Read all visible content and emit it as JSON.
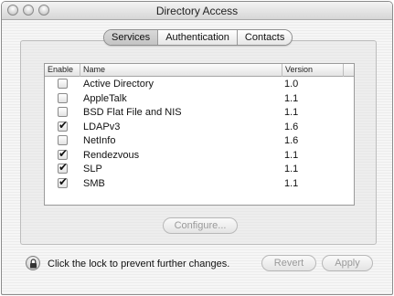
{
  "window": {
    "title": "Directory Access"
  },
  "tabs": [
    {
      "label": "Services",
      "active": true
    },
    {
      "label": "Authentication",
      "active": false
    },
    {
      "label": "Contacts",
      "active": false
    }
  ],
  "table": {
    "headers": {
      "enable": "Enable",
      "name": "Name",
      "version": "Version"
    },
    "rows": [
      {
        "enabled": false,
        "name": "Active Directory",
        "version": "1.0"
      },
      {
        "enabled": false,
        "name": "AppleTalk",
        "version": "1.1"
      },
      {
        "enabled": false,
        "name": "BSD Flat File and NIS",
        "version": "1.1"
      },
      {
        "enabled": true,
        "name": "LDAPv3",
        "version": "1.6"
      },
      {
        "enabled": false,
        "name": "NetInfo",
        "version": "1.6"
      },
      {
        "enabled": true,
        "name": "Rendezvous",
        "version": "1.1"
      },
      {
        "enabled": true,
        "name": "SLP",
        "version": "1.1"
      },
      {
        "enabled": true,
        "name": "SMB",
        "version": "1.1"
      }
    ]
  },
  "buttons": {
    "configure": "Configure...",
    "revert": "Revert",
    "apply": "Apply"
  },
  "lock": {
    "message": "Click the lock to prevent further changes.",
    "icon": "lock-icon"
  }
}
